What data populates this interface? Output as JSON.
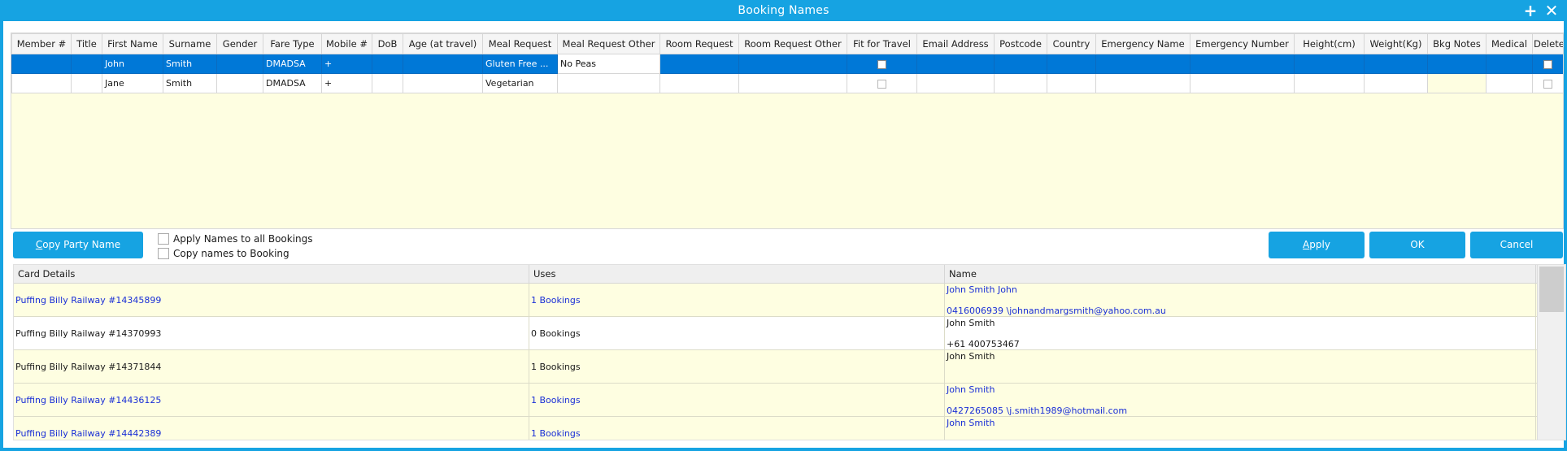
{
  "window": {
    "title": "Booking Names"
  },
  "grid": {
    "columns": [
      "Member #",
      "Title",
      "First Name",
      "Surname",
      "Gender",
      "Fare Type",
      "Mobile #",
      "DoB",
      "Age (at travel)",
      "Meal Request",
      "Meal Request Other",
      "Room Request",
      "Room Request Other",
      "Fit for Travel",
      "Email Address",
      "Postcode",
      "Country",
      "Emergency Name",
      "Emergency Number",
      "Height(cm)",
      "Weight(Kg)",
      "Bkg Notes",
      "Medical",
      "Delete"
    ],
    "rows": [
      {
        "first_name": "John",
        "surname": "Smith",
        "fare_type": "DMADSA",
        "mobile": "+",
        "meal_request": "Gluten Free ...",
        "meal_request_other": "No Peas",
        "selected": true
      },
      {
        "first_name": "Jane",
        "surname": "Smith",
        "fare_type": "DMADSA",
        "mobile": "+",
        "meal_request": "Vegetarian",
        "meal_request_other": "",
        "selected": false
      }
    ]
  },
  "actions": {
    "copy_party_name_prefix": "C",
    "copy_party_name_rest": "opy Party Name",
    "apply_names_all": "Apply Names to all Bookings",
    "copy_names_booking": "Copy names to Booking",
    "apply_prefix": "A",
    "apply_rest": "pply",
    "ok": "OK",
    "cancel": "Cancel"
  },
  "cards": {
    "columns": [
      "Card Details",
      "Uses",
      "Name"
    ],
    "rows": [
      {
        "details": "Puffing Billy Railway #14345899",
        "uses": "1 Bookings",
        "name": "John Smith John",
        "contact": "0416006939 \\johnandmargsmith@yahoo.com.au",
        "link": true
      },
      {
        "details": "Puffing Billy Railway #14370993",
        "uses": "0 Bookings",
        "name": "John Smith",
        "contact": "+61  400753467",
        "link": false
      },
      {
        "details": "Puffing Billy Railway #14371844",
        "uses": "1 Bookings",
        "name": "John Smith",
        "contact": "",
        "link": false
      },
      {
        "details": "Puffing Billy Railway #14436125",
        "uses": "1 Bookings",
        "name": "John Smith",
        "contact": "0427265085 \\j.smith1989@hotmail.com",
        "link": true
      },
      {
        "details": "Puffing Billy Railway #14442389",
        "uses": "1 Bookings",
        "name": "John Smith",
        "contact": "",
        "link": true
      }
    ]
  },
  "colors": {
    "accent": "#16a3e2",
    "selected_row": "#0078d7",
    "grid_bg": "#fefee1",
    "link": "#1a2fd6"
  }
}
